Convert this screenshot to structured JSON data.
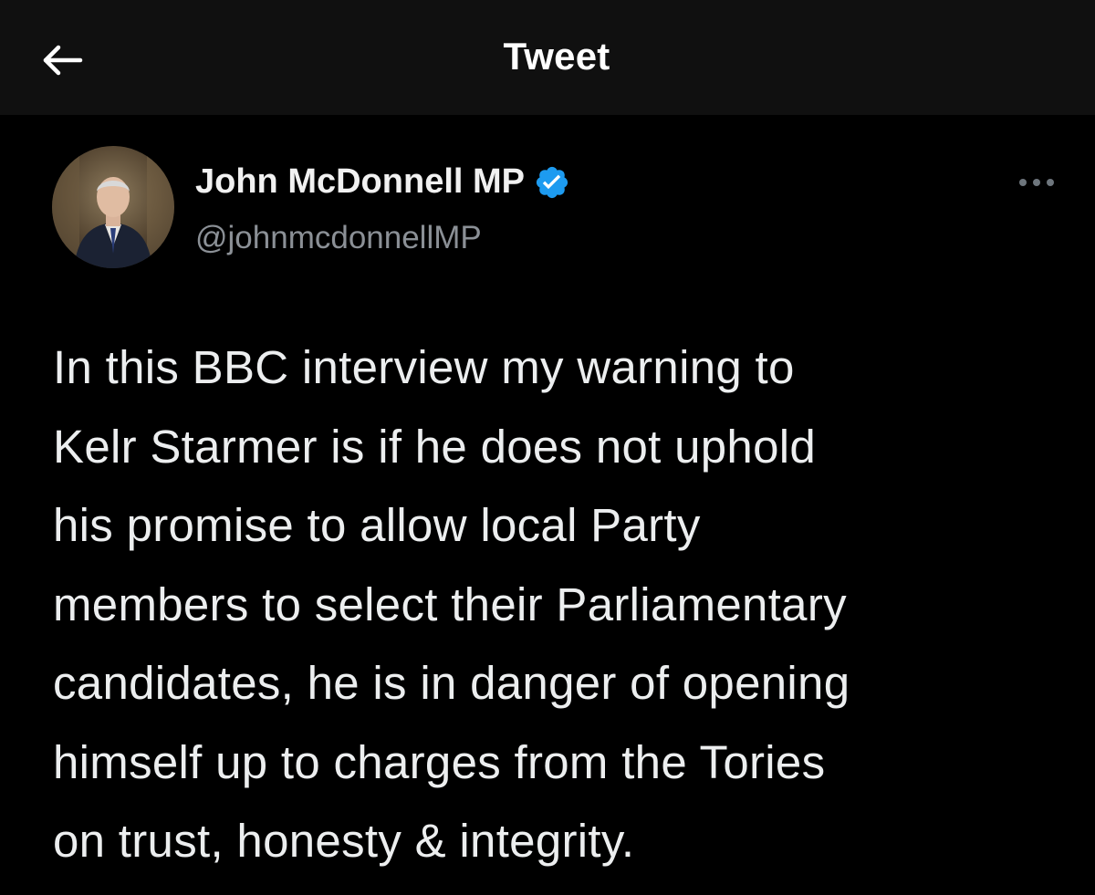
{
  "header": {
    "title": "Tweet",
    "back_icon": "arrow-left-icon"
  },
  "tweet": {
    "author": {
      "display_name": "John McDonnell MP",
      "handle": "@johnmcdonnellMP",
      "verified": true,
      "verified_icon": "verified-badge-icon",
      "avatar_icon": "profile-photo"
    },
    "more_icon": "more-options-icon",
    "text_lines": [
      "In this BBC interview my warning to",
      "Kelr Starmer is if he does not uphold",
      "his promise to allow local Party",
      "members to select their Parliamentary",
      "candidates, he is in danger of opening",
      "himself up to charges from the Tories",
      "on trust, honesty & integrity."
    ]
  },
  "colors": {
    "header_background": "#101010",
    "background": "#000000",
    "text": "#e7e9ea",
    "secondary_text": "#8b9096",
    "verified_blue": "#1d9bf0"
  }
}
